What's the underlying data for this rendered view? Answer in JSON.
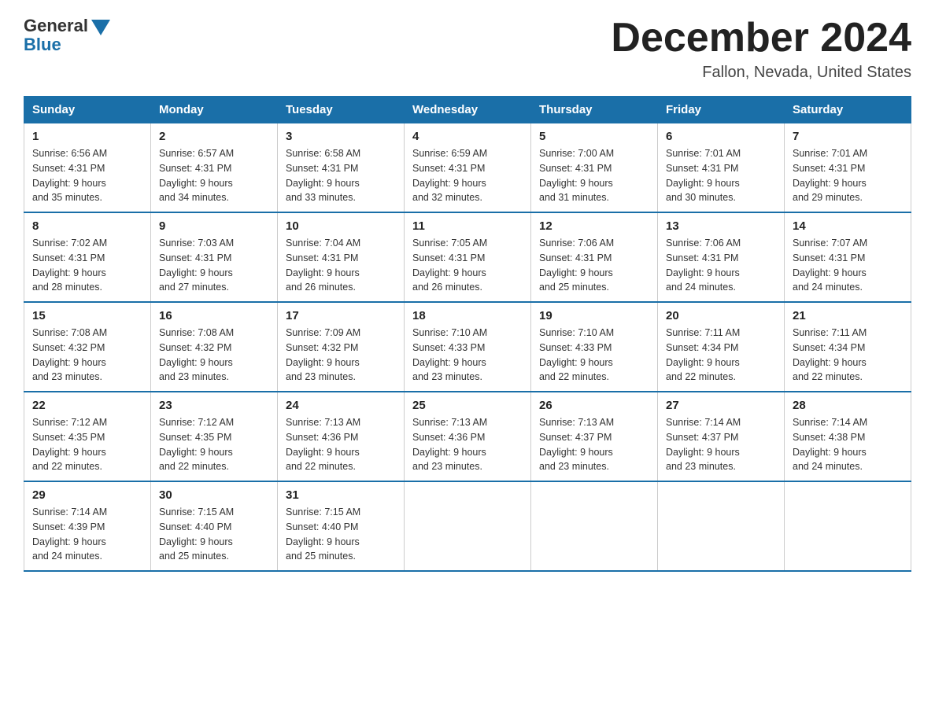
{
  "header": {
    "logo_general": "General",
    "logo_blue": "Blue",
    "title": "December 2024",
    "subtitle": "Fallon, Nevada, United States"
  },
  "weekdays": [
    "Sunday",
    "Monday",
    "Tuesday",
    "Wednesday",
    "Thursday",
    "Friday",
    "Saturday"
  ],
  "weeks": [
    [
      {
        "day": "1",
        "sunrise": "6:56 AM",
        "sunset": "4:31 PM",
        "daylight": "9 hours and 35 minutes."
      },
      {
        "day": "2",
        "sunrise": "6:57 AM",
        "sunset": "4:31 PM",
        "daylight": "9 hours and 34 minutes."
      },
      {
        "day": "3",
        "sunrise": "6:58 AM",
        "sunset": "4:31 PM",
        "daylight": "9 hours and 33 minutes."
      },
      {
        "day": "4",
        "sunrise": "6:59 AM",
        "sunset": "4:31 PM",
        "daylight": "9 hours and 32 minutes."
      },
      {
        "day": "5",
        "sunrise": "7:00 AM",
        "sunset": "4:31 PM",
        "daylight": "9 hours and 31 minutes."
      },
      {
        "day": "6",
        "sunrise": "7:01 AM",
        "sunset": "4:31 PM",
        "daylight": "9 hours and 30 minutes."
      },
      {
        "day": "7",
        "sunrise": "7:01 AM",
        "sunset": "4:31 PM",
        "daylight": "9 hours and 29 minutes."
      }
    ],
    [
      {
        "day": "8",
        "sunrise": "7:02 AM",
        "sunset": "4:31 PM",
        "daylight": "9 hours and 28 minutes."
      },
      {
        "day": "9",
        "sunrise": "7:03 AM",
        "sunset": "4:31 PM",
        "daylight": "9 hours and 27 minutes."
      },
      {
        "day": "10",
        "sunrise": "7:04 AM",
        "sunset": "4:31 PM",
        "daylight": "9 hours and 26 minutes."
      },
      {
        "day": "11",
        "sunrise": "7:05 AM",
        "sunset": "4:31 PM",
        "daylight": "9 hours and 26 minutes."
      },
      {
        "day": "12",
        "sunrise": "7:06 AM",
        "sunset": "4:31 PM",
        "daylight": "9 hours and 25 minutes."
      },
      {
        "day": "13",
        "sunrise": "7:06 AM",
        "sunset": "4:31 PM",
        "daylight": "9 hours and 24 minutes."
      },
      {
        "day": "14",
        "sunrise": "7:07 AM",
        "sunset": "4:31 PM",
        "daylight": "9 hours and 24 minutes."
      }
    ],
    [
      {
        "day": "15",
        "sunrise": "7:08 AM",
        "sunset": "4:32 PM",
        "daylight": "9 hours and 23 minutes."
      },
      {
        "day": "16",
        "sunrise": "7:08 AM",
        "sunset": "4:32 PM",
        "daylight": "9 hours and 23 minutes."
      },
      {
        "day": "17",
        "sunrise": "7:09 AM",
        "sunset": "4:32 PM",
        "daylight": "9 hours and 23 minutes."
      },
      {
        "day": "18",
        "sunrise": "7:10 AM",
        "sunset": "4:33 PM",
        "daylight": "9 hours and 23 minutes."
      },
      {
        "day": "19",
        "sunrise": "7:10 AM",
        "sunset": "4:33 PM",
        "daylight": "9 hours and 22 minutes."
      },
      {
        "day": "20",
        "sunrise": "7:11 AM",
        "sunset": "4:34 PM",
        "daylight": "9 hours and 22 minutes."
      },
      {
        "day": "21",
        "sunrise": "7:11 AM",
        "sunset": "4:34 PM",
        "daylight": "9 hours and 22 minutes."
      }
    ],
    [
      {
        "day": "22",
        "sunrise": "7:12 AM",
        "sunset": "4:35 PM",
        "daylight": "9 hours and 22 minutes."
      },
      {
        "day": "23",
        "sunrise": "7:12 AM",
        "sunset": "4:35 PM",
        "daylight": "9 hours and 22 minutes."
      },
      {
        "day": "24",
        "sunrise": "7:13 AM",
        "sunset": "4:36 PM",
        "daylight": "9 hours and 22 minutes."
      },
      {
        "day": "25",
        "sunrise": "7:13 AM",
        "sunset": "4:36 PM",
        "daylight": "9 hours and 23 minutes."
      },
      {
        "day": "26",
        "sunrise": "7:13 AM",
        "sunset": "4:37 PM",
        "daylight": "9 hours and 23 minutes."
      },
      {
        "day": "27",
        "sunrise": "7:14 AM",
        "sunset": "4:37 PM",
        "daylight": "9 hours and 23 minutes."
      },
      {
        "day": "28",
        "sunrise": "7:14 AM",
        "sunset": "4:38 PM",
        "daylight": "9 hours and 24 minutes."
      }
    ],
    [
      {
        "day": "29",
        "sunrise": "7:14 AM",
        "sunset": "4:39 PM",
        "daylight": "9 hours and 24 minutes."
      },
      {
        "day": "30",
        "sunrise": "7:15 AM",
        "sunset": "4:40 PM",
        "daylight": "9 hours and 25 minutes."
      },
      {
        "day": "31",
        "sunrise": "7:15 AM",
        "sunset": "4:40 PM",
        "daylight": "9 hours and 25 minutes."
      },
      null,
      null,
      null,
      null
    ]
  ],
  "labels": {
    "sunrise": "Sunrise:",
    "sunset": "Sunset:",
    "daylight": "Daylight:"
  }
}
